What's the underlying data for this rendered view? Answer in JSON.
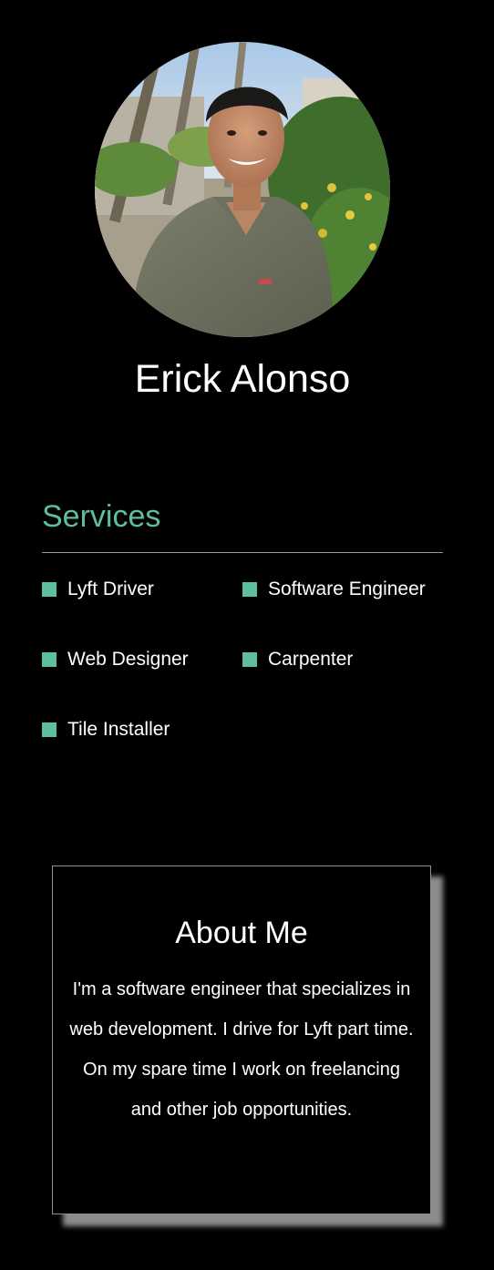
{
  "profile": {
    "name": "Erick Alonso",
    "photo_description": "profile-photo"
  },
  "services": {
    "heading": "Services",
    "items": [
      {
        "label": "Lyft Driver"
      },
      {
        "label": "Software Engineer"
      },
      {
        "label": "Web Designer"
      },
      {
        "label": "Carpenter"
      },
      {
        "label": "Tile Installer"
      }
    ]
  },
  "about": {
    "title": "About Me",
    "body": "I'm a software engineer that specializes in web development. I drive for Lyft part time. On my spare time I work on freelancing and other job opportunities."
  },
  "colors": {
    "background": "#000000",
    "accent": "#5dbf9b",
    "text": "#ffffff",
    "divider": "#9a9a9a"
  }
}
